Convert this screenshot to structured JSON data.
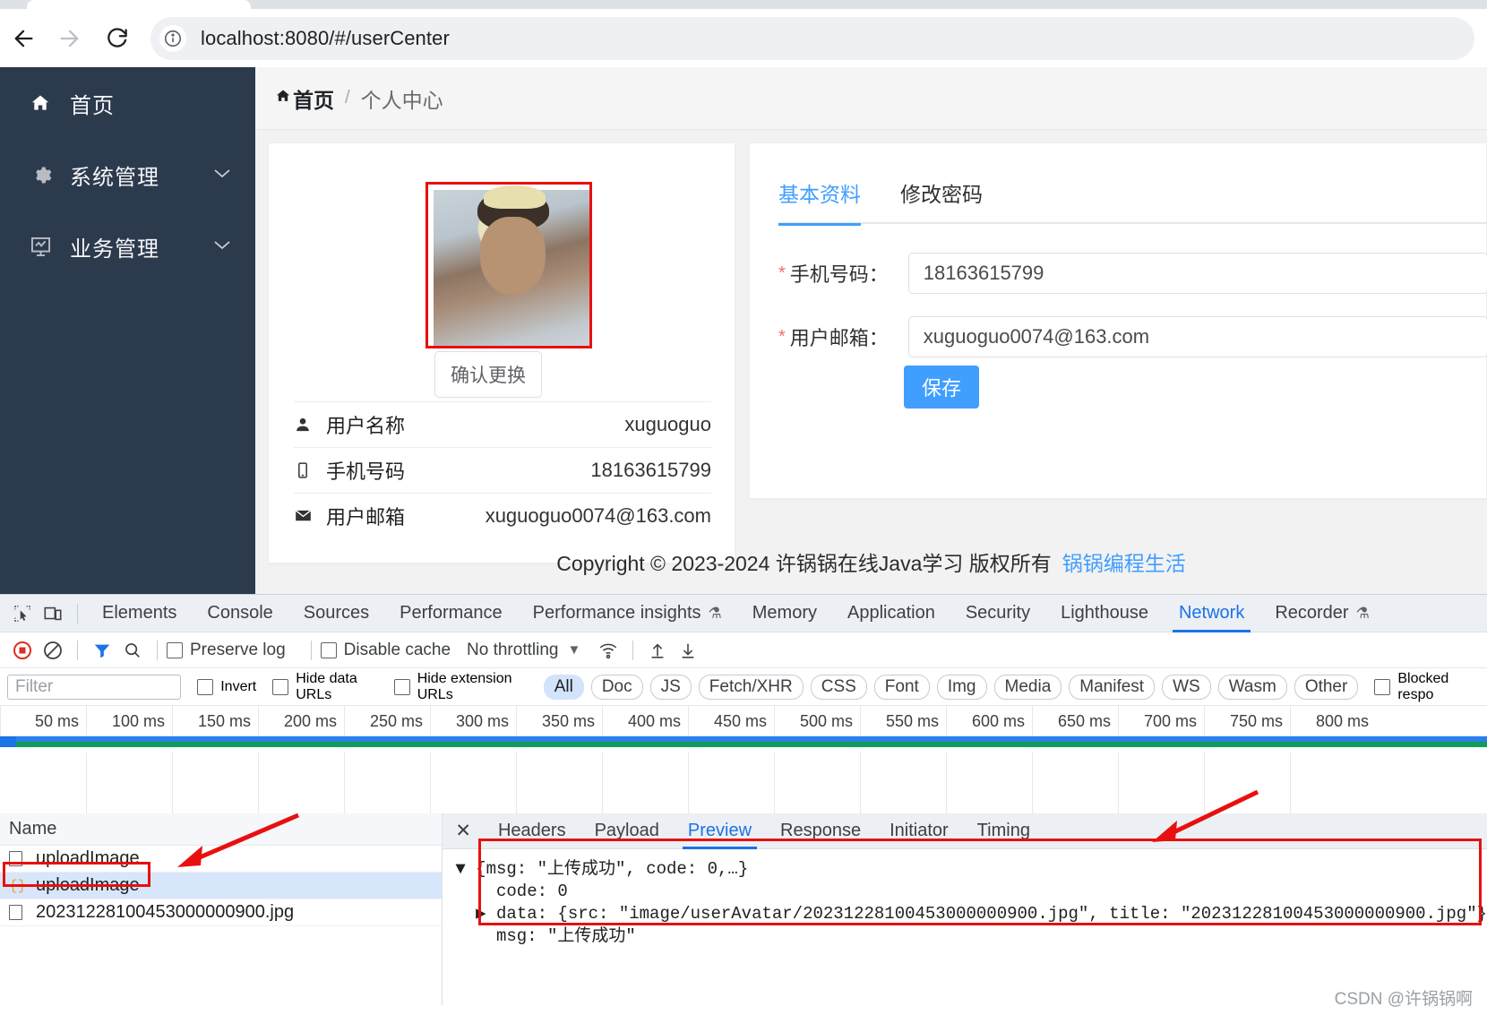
{
  "browser": {
    "url": "localhost:8080/#/userCenter",
    "back_icon": "back-arrow-icon",
    "forward_icon": "forward-arrow-icon",
    "reload_icon": "reload-icon",
    "info_icon": "info-circle-icon"
  },
  "sidebar": {
    "items": [
      {
        "label": "首页",
        "icon": "home-icon",
        "expandable": false
      },
      {
        "label": "系统管理",
        "icon": "gear-icon",
        "expandable": true
      },
      {
        "label": "业务管理",
        "icon": "chart-monitor-icon",
        "expandable": true
      }
    ]
  },
  "breadcrumb": {
    "home": "首页",
    "separator": "/",
    "current": "个人中心"
  },
  "profile_card": {
    "change_avatar_label": "确认更换",
    "rows": [
      {
        "icon": "user-icon",
        "label": "用户名称",
        "value": "xuguoguo"
      },
      {
        "icon": "phone-icon",
        "label": "手机号码",
        "value": "18163615799"
      },
      {
        "icon": "mail-icon",
        "label": "用户邮箱",
        "value": "xuguoguo0074@163.com"
      }
    ]
  },
  "settings_card": {
    "tabs": [
      {
        "label": "基本资料",
        "active": true
      },
      {
        "label": "修改密码",
        "active": false
      }
    ],
    "fields": [
      {
        "required": "*",
        "label": "手机号码：",
        "value": "18163615799"
      },
      {
        "required": "*",
        "label": "用户邮箱：",
        "value": "xuguoguo0074@163.com"
      }
    ],
    "save_label": "保存"
  },
  "footer": {
    "text": "Copyright © 2023-2024 许锅锅在线Java学习 版权所有",
    "link": "锅锅编程生活"
  },
  "devtools": {
    "tabs": [
      {
        "label": "Elements",
        "active": false,
        "beaker": false
      },
      {
        "label": "Console",
        "active": false,
        "beaker": false
      },
      {
        "label": "Sources",
        "active": false,
        "beaker": false
      },
      {
        "label": "Performance",
        "active": false,
        "beaker": false
      },
      {
        "label": "Performance insights",
        "active": false,
        "beaker": true
      },
      {
        "label": "Memory",
        "active": false,
        "beaker": false
      },
      {
        "label": "Application",
        "active": false,
        "beaker": false
      },
      {
        "label": "Security",
        "active": false,
        "beaker": false
      },
      {
        "label": "Lighthouse",
        "active": false,
        "beaker": false
      },
      {
        "label": "Network",
        "active": true,
        "beaker": false
      },
      {
        "label": "Recorder",
        "active": false,
        "beaker": true
      }
    ],
    "beaker_glyph": "⚗",
    "controls": {
      "record_icon": "record-stop-icon",
      "clear_icon": "clear-icon",
      "filter_icon": "funnel-icon",
      "search_icon": "search-icon",
      "preserve_log": "Preserve log",
      "disable_cache": "Disable cache",
      "throttling": "No throttling",
      "throttle_caret": "▼",
      "wifi_icon": "wifi-settings-icon",
      "import_icon": "import-har-icon",
      "export_icon": "export-har-icon"
    },
    "filters": {
      "placeholder": "Filter",
      "invert": "Invert",
      "hide_data_urls": "Hide data URLs",
      "hide_extension_urls": "Hide extension URLs",
      "blocked": "Blocked respo",
      "types": [
        "All",
        "Doc",
        "JS",
        "Fetch/XHR",
        "CSS",
        "Font",
        "Img",
        "Media",
        "Manifest",
        "WS",
        "Wasm",
        "Other"
      ],
      "active_type": "All"
    },
    "timeline_ticks": [
      "50 ms",
      "100 ms",
      "150 ms",
      "200 ms",
      "250 ms",
      "300 ms",
      "350 ms",
      "400 ms",
      "450 ms",
      "500 ms",
      "550 ms",
      "600 ms",
      "650 ms",
      "700 ms",
      "750 ms",
      "800 ms"
    ],
    "requests": {
      "column_header": "Name",
      "rows": [
        {
          "name": "uploadImage",
          "icon": "document-icon",
          "selected": false
        },
        {
          "name": "uploadImage",
          "icon": "json-icon",
          "selected": true
        },
        {
          "name": "20231228100453000000900.jpg",
          "icon": "document-icon",
          "selected": false
        }
      ]
    },
    "detail": {
      "close_icon": "close-icon",
      "tabs": [
        {
          "label": "Headers",
          "active": false
        },
        {
          "label": "Payload",
          "active": false
        },
        {
          "label": "Preview",
          "active": true
        },
        {
          "label": "Response",
          "active": false
        },
        {
          "label": "Initiator",
          "active": false
        },
        {
          "label": "Timing",
          "active": false
        }
      ],
      "preview_lines": [
        "▼ {msg: \"上传成功\", code: 0,…}",
        "    code: 0",
        "  ▶ data: {src: \"image/userAvatar/20231228100453000000900.jpg\", title: \"20231228100453000000900.jpg\"}",
        "    msg: \"上传成功\""
      ]
    }
  },
  "watermark": "CSDN @许锅锅啊",
  "colors": {
    "accent": "#409eff",
    "sidebar_bg": "#2c3a4e",
    "annotation_red": "#e8100f",
    "devtools_active": "#1a73e8"
  }
}
